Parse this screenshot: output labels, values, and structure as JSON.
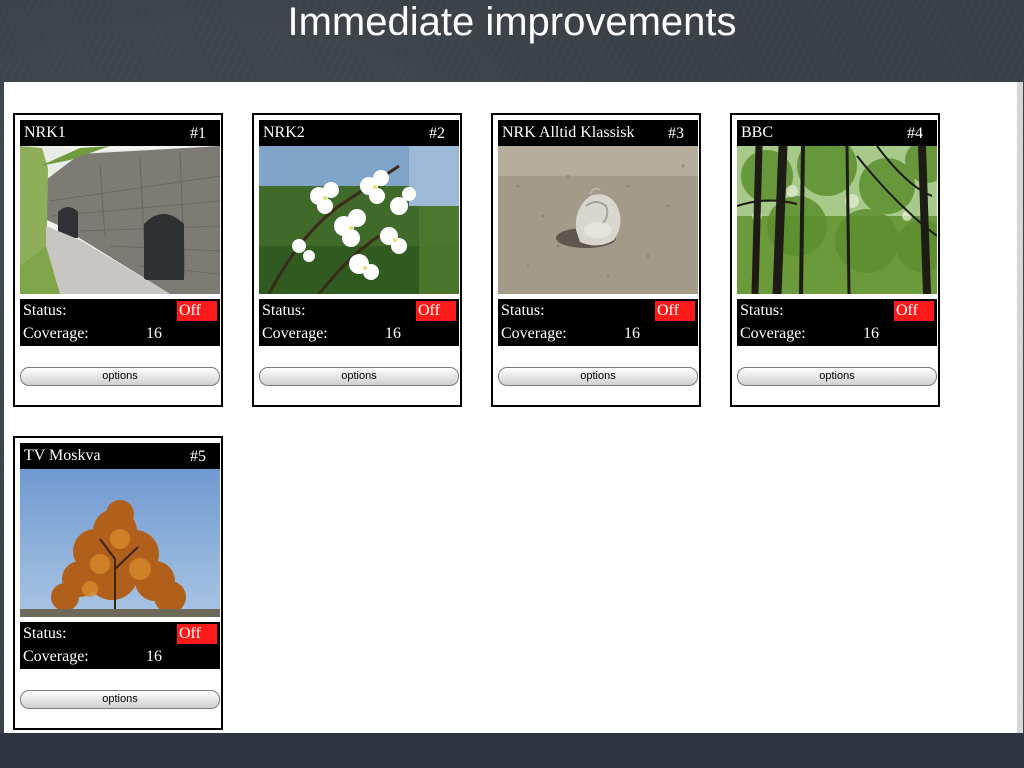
{
  "slide": {
    "title": "Immediate improvements"
  },
  "labels": {
    "status": "Status:",
    "coverage": "Coverage:",
    "options": "options"
  },
  "colors": {
    "status_off": "#ff1a1a",
    "card_bar": "#000000"
  },
  "channels": [
    {
      "name": "NRK1",
      "number": "#1",
      "status": "Off",
      "coverage": "16",
      "image": "stone-wall-photo"
    },
    {
      "name": "NRK2",
      "number": "#2",
      "status": "Off",
      "coverage": "16",
      "image": "white-blossom-photo"
    },
    {
      "name": "NRK Alltid Klassisk",
      "number": "#3",
      "status": "Off",
      "coverage": "16",
      "image": "snail-shell-photo"
    },
    {
      "name": "BBC",
      "number": "#4",
      "status": "Off",
      "coverage": "16",
      "image": "forest-trees-photo"
    },
    {
      "name": "TV Moskva",
      "number": "#5",
      "status": "Off",
      "coverage": "16",
      "image": "autumn-tree-photo"
    }
  ]
}
